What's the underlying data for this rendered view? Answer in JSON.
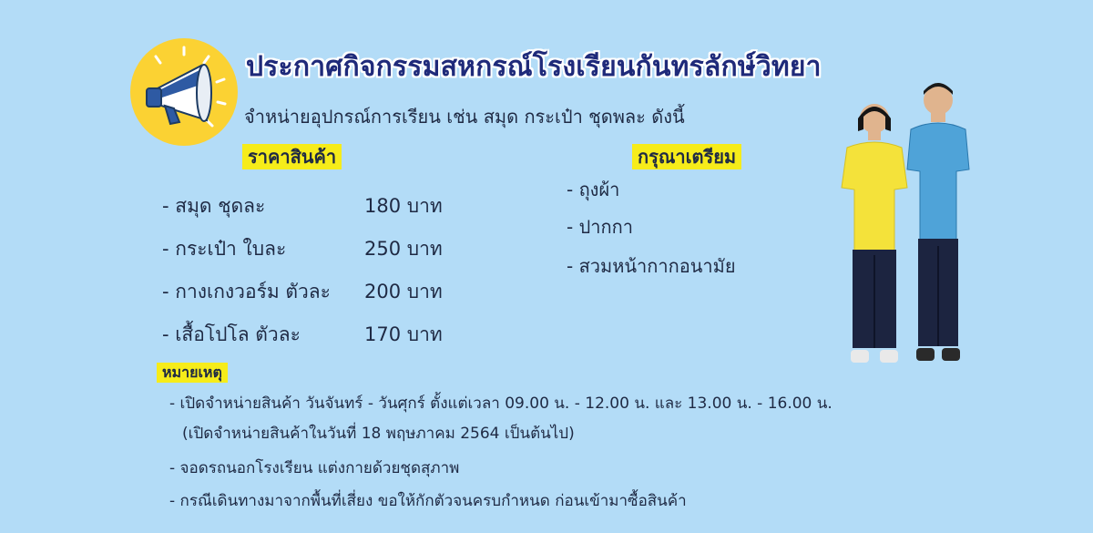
{
  "header": {
    "title": "ประกาศกิจกรรมสหกรณ์โรงเรียนกันทรลักษ์วิทยา",
    "subtitle": "จำหน่ายอุปกรณ์การเรียน เช่น สมุด กระเป๋า ชุดพละ ดังนี้"
  },
  "prices": {
    "heading": "ราคาสินค้า",
    "items": [
      {
        "label": "- สมุด ชุดละ",
        "amount": "180 บาท"
      },
      {
        "label": "- กระเป๋า ใบละ",
        "amount": "250 บาท"
      },
      {
        "label": "- กางเกงวอร์ม ตัวละ",
        "amount": "200 บาท"
      },
      {
        "label": "- เสื้อโปโล ตัวละ",
        "amount": "170 บาท"
      }
    ]
  },
  "prepare": {
    "heading": "กรุณาเตรียม",
    "items": [
      "- ถุงผ้า",
      "- ปากกา",
      "- สวมหน้ากากอนามัย"
    ]
  },
  "notes": {
    "heading": "หมายเหตุ",
    "lines": [
      "- เปิดจำหน่ายสินค้า วันจันทร์ - วันศุกร์ ตั้งแต่เวลา 09.00 น. - 12.00 น. และ 13.00 น. - 16.00 น.",
      "(เปิดจำหน่ายสินค้าในวันที่ 18 พฤษภาคม 2564 เป็นต้นไป)",
      "- จอดรถนอกโรงเรียน  แต่งกายด้วยชุดสุภาพ",
      "- กรณีเดินทางมาจากพื้นที่เสี่ยง ขอให้กักตัวจนครบกำหนด ก่อนเข้ามาซื้อสินค้า"
    ]
  },
  "icons": {
    "announcement": "megaphone-icon",
    "students": "students-in-uniform-illustration"
  },
  "colors": {
    "background": "#b3dcf7",
    "highlight": "#f6ec1a",
    "badge": "#fbd233",
    "title": "#1f2a7a"
  }
}
